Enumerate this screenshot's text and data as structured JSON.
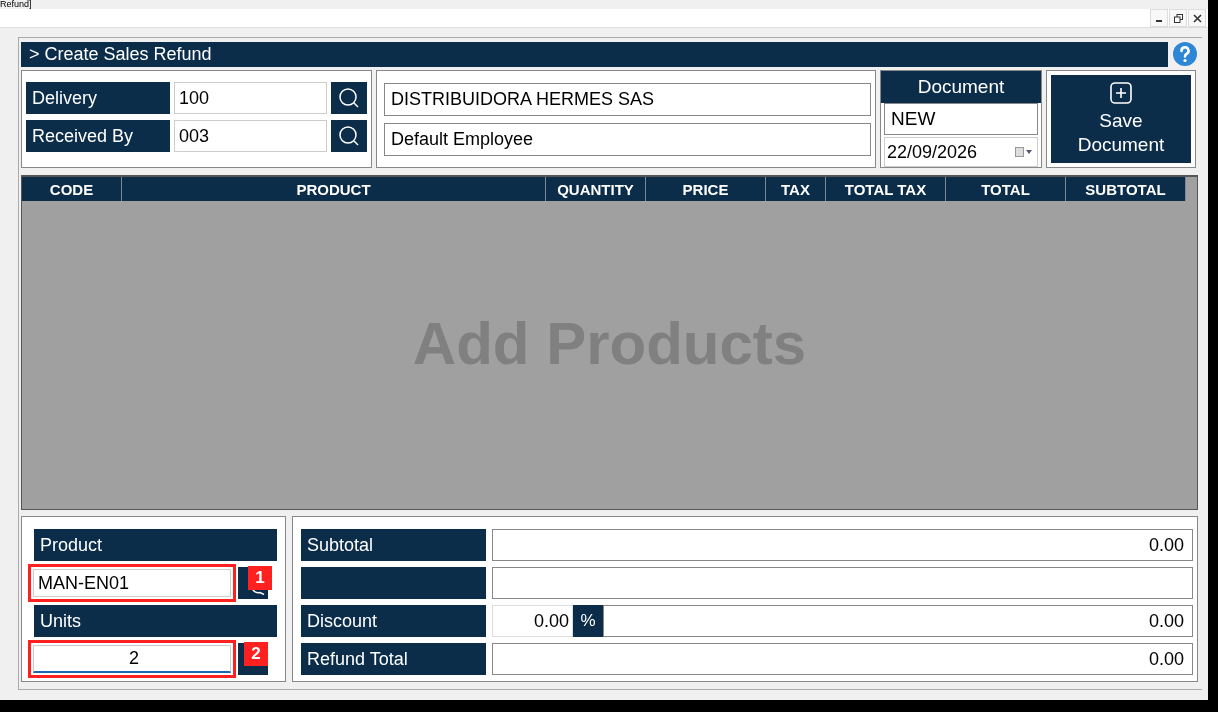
{
  "window": {
    "title": "Refund]"
  },
  "page_title": "> Create Sales Refund",
  "lookups": [
    {
      "label": "Delivery",
      "value": "100"
    },
    {
      "label": "Received By",
      "value": "003"
    }
  ],
  "names": [
    "DISTRIBUIDORA HERMES SAS",
    "Default Employee"
  ],
  "document": {
    "label": "Document",
    "number": "NEW",
    "date": "22/09/2026"
  },
  "save_button": "Save Document",
  "table": {
    "columns": [
      "CODE",
      "PRODUCT",
      "QUANTITY",
      "PRICE",
      "TAX",
      "TOTAL TAX",
      "TOTAL",
      "SUBTOTAL"
    ],
    "empty_text": "Add Products"
  },
  "entry": {
    "product_label": "Product",
    "product_value": "MAN-EN01",
    "units_label": "Units",
    "units_value": "2",
    "units_focused": true
  },
  "callouts": [
    "1",
    "2"
  ],
  "totals": [
    {
      "kind": "plain",
      "label": "Subtotal",
      "value": "0.00"
    },
    {
      "kind": "plain"
    },
    {
      "kind": "discount",
      "label": "Discount",
      "percent": "0.00",
      "unit": "%",
      "value": "0.00"
    },
    {
      "kind": "plain",
      "label": "Refund Total",
      "value": "0.00"
    }
  ]
}
